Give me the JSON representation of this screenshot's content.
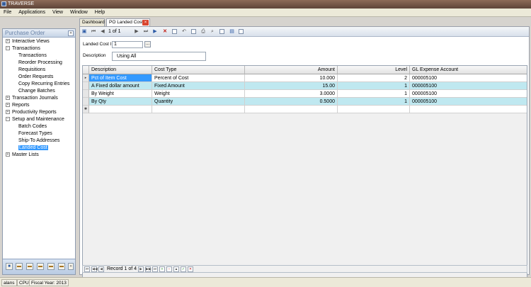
{
  "app_title": "TRAVERSE",
  "menu": [
    "File",
    "Applications",
    "View",
    "Window",
    "Help"
  ],
  "nav": {
    "title": "Purchase Order",
    "collapse_icon": "«",
    "items": [
      {
        "label": "Interactive Views",
        "toggle": "+"
      },
      {
        "label": "Transactions",
        "toggle": "−"
      },
      {
        "label": "Transactions"
      },
      {
        "label": "Reorder Processing"
      },
      {
        "label": "Requisitions"
      },
      {
        "label": "Order Requests"
      },
      {
        "label": "Copy Recurring Entries"
      },
      {
        "label": "Change Batches"
      },
      {
        "label": "Transaction Journals",
        "toggle": "+"
      },
      {
        "label": "Reports",
        "toggle": "+"
      },
      {
        "label": "Productivity Reports",
        "toggle": "+"
      },
      {
        "label": "Setup and Maintenance",
        "toggle": "−"
      },
      {
        "label": "Batch Codes"
      },
      {
        "label": "Forecast Types"
      },
      {
        "label": "Ship-To Addresses"
      },
      {
        "label": "Landed Cost"
      },
      {
        "label": "Master Lists",
        "toggle": "+"
      }
    ]
  },
  "tabs": [
    {
      "label": "Dashboard"
    },
    {
      "label": "PO Landed Cost",
      "close": "×"
    }
  ],
  "toolbar": {
    "record_position": "1",
    "record_total": "of 1"
  },
  "form": {
    "landed_cost_id_label": "Landed Cost ID",
    "landed_cost_id_value": "1",
    "description_label": "Description",
    "description_value": "Using All",
    "lookup_button": "..."
  },
  "grid": {
    "columns": [
      "Description",
      "Cost Type",
      "Amount",
      "Level",
      "GL Expense Account"
    ],
    "rows": [
      {
        "description": "Pct of Item Cost",
        "cost_type": "Percent of Cost",
        "amount": "10.000",
        "level": "2",
        "gl_account": "000005100"
      },
      {
        "description": "A Fixed dollar amount",
        "cost_type": "Fixed Amount",
        "amount": "15.00",
        "level": "1",
        "gl_account": "000005100"
      },
      {
        "description": "By Weight",
        "cost_type": "Weight",
        "amount": "3.0000",
        "level": "1",
        "gl_account": "000005100"
      },
      {
        "description": "By Qty",
        "cost_type": "Quantity",
        "amount": "0.5000",
        "level": "1",
        "gl_account": "000005100"
      }
    ],
    "current_row_marker": "▸",
    "new_row_marker": "✱"
  },
  "record_nav": {
    "text": "Record 1 of 4"
  },
  "status": {
    "user": "alans",
    "cpu": "CPU",
    "fiscal_year": "Fiscal Year: 2013"
  },
  "colors": {
    "selection": "#3399ff",
    "alt_row": "#bfe8f0",
    "title_bar": "#6b4d3f"
  }
}
